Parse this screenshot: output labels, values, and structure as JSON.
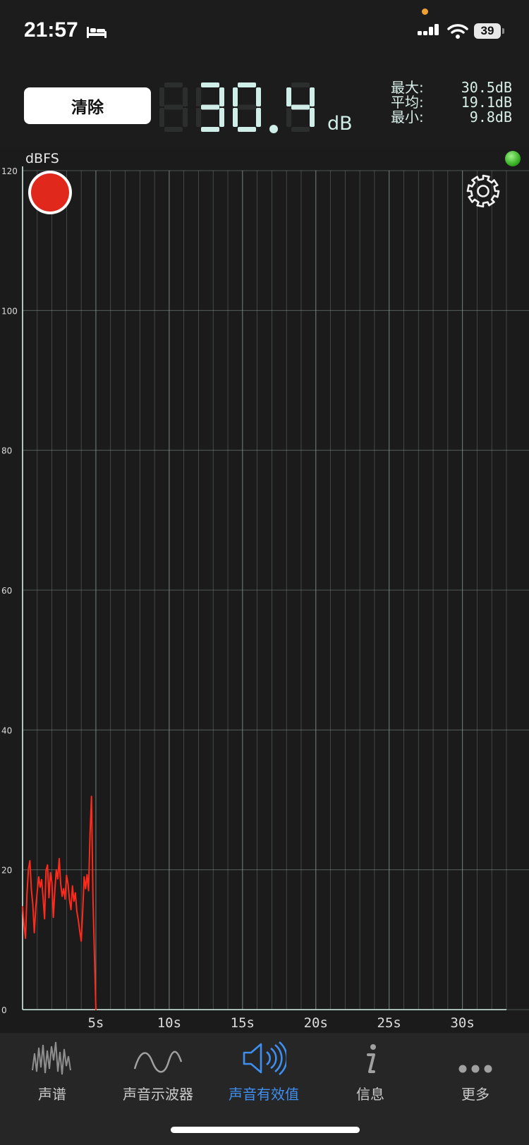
{
  "status_bar": {
    "time": "21:57",
    "battery": "39"
  },
  "header": {
    "clear_label": "清除",
    "reading_digits": [
      "",
      "3",
      "0",
      ".",
      "4"
    ],
    "reading": "30.4",
    "unit": "dB",
    "stats": [
      {
        "label": "最大:",
        "value": "30.5dB"
      },
      {
        "label": "平均:",
        "value": "19.1dB"
      },
      {
        "label": "最小:",
        "value": "9.8dB"
      }
    ]
  },
  "colors": {
    "trace": "#ff2a1a",
    "accent": "#3f8ff0",
    "record": "#e0281d",
    "led": "#37b024",
    "grid": "#8a9a96",
    "axis": "#d6efe9"
  },
  "chart_data": {
    "type": "line",
    "ylabel": "dBFS",
    "ylim": [
      0,
      120
    ],
    "y_ticks": [
      0,
      20,
      40,
      60,
      80,
      100,
      120
    ],
    "xlim": [
      0,
      33
    ],
    "x_ticks": [
      {
        "value": 5,
        "label": "5s"
      },
      {
        "value": 10,
        "label": "10s"
      },
      {
        "value": 15,
        "label": "15s"
      },
      {
        "value": 20,
        "label": "20s"
      },
      {
        "value": 25,
        "label": "25s"
      },
      {
        "value": 30,
        "label": "30s"
      }
    ],
    "grid": true,
    "series": [
      {
        "x": [
          0.0,
          0.1,
          0.2,
          0.3,
          0.4,
          0.5,
          0.6,
          0.7,
          0.8,
          0.9,
          1.0,
          1.1,
          1.2,
          1.3,
          1.4,
          1.5,
          1.6,
          1.7,
          1.8,
          1.9,
          2.0,
          2.1,
          2.2,
          2.3,
          2.4,
          2.5,
          2.6,
          2.7,
          2.8,
          2.9,
          3.0,
          3.1,
          3.2,
          3.3,
          3.4,
          3.5,
          3.6,
          3.7,
          3.8,
          3.9,
          4.0,
          4.1,
          4.2,
          4.3,
          4.4,
          4.5,
          4.6,
          4.7,
          4.8,
          4.9,
          5.0,
          5.02,
          5.05
        ],
        "y": [
          14.8,
          12.1,
          10.2,
          16.5,
          20.1,
          21.3,
          17.2,
          15.0,
          11.0,
          14.6,
          16.9,
          19.0,
          17.5,
          18.6,
          16.0,
          13.0,
          19.9,
          20.7,
          16.0,
          19.6,
          18.2,
          13.2,
          17.0,
          20.0,
          18.7,
          21.6,
          18.0,
          16.2,
          17.3,
          15.8,
          19.2,
          18.0,
          15.7,
          14.3,
          17.7,
          15.5,
          16.7,
          14.1,
          12.8,
          11.2,
          9.8,
          14.0,
          19.0,
          17.3,
          19.3,
          17.0,
          25.0,
          30.5,
          16.0,
          8.0,
          0.0,
          0.0,
          0.0
        ]
      }
    ]
  },
  "tabs": [
    {
      "label": "声谱",
      "icon": "spectrum-icon",
      "active": false
    },
    {
      "label": "声音示波器",
      "icon": "waveform-icon",
      "active": false
    },
    {
      "label": "声音有效值",
      "icon": "speaker-icon",
      "active": true
    },
    {
      "label": "信息",
      "icon": "info-icon",
      "active": false
    },
    {
      "label": "更多",
      "icon": "more-icon",
      "active": false
    }
  ]
}
